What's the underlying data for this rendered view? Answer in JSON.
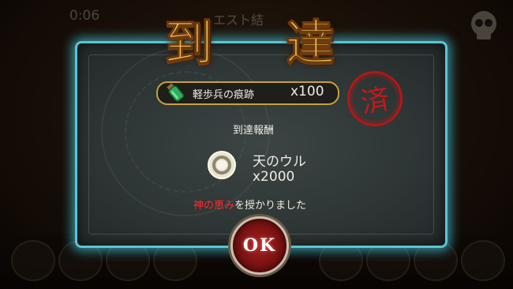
{
  "hud": {
    "timer": "0:06",
    "quest_result_title": "エスト結"
  },
  "banner": {
    "left_char": "到",
    "right_char": "達"
  },
  "condition": {
    "label": "軽歩兵の痕跡",
    "count": "x100",
    "icon": "green-bottle-icon"
  },
  "stamp": {
    "text": "済",
    "color": "#c21a1a"
  },
  "reward": {
    "heading": "到達報酬",
    "name": "天のウル",
    "quantity": "x2000",
    "icon": "ring-orb-icon"
  },
  "blessing": {
    "highlight": "神の恵み",
    "rest": "を授かりました",
    "highlight_color": "#ff2a2a"
  },
  "ok_button": {
    "label": "OK"
  },
  "colors": {
    "panel_glow": "#57c6d6",
    "banner_gold": "#f3c24a",
    "row_border": "#c9a03c"
  }
}
